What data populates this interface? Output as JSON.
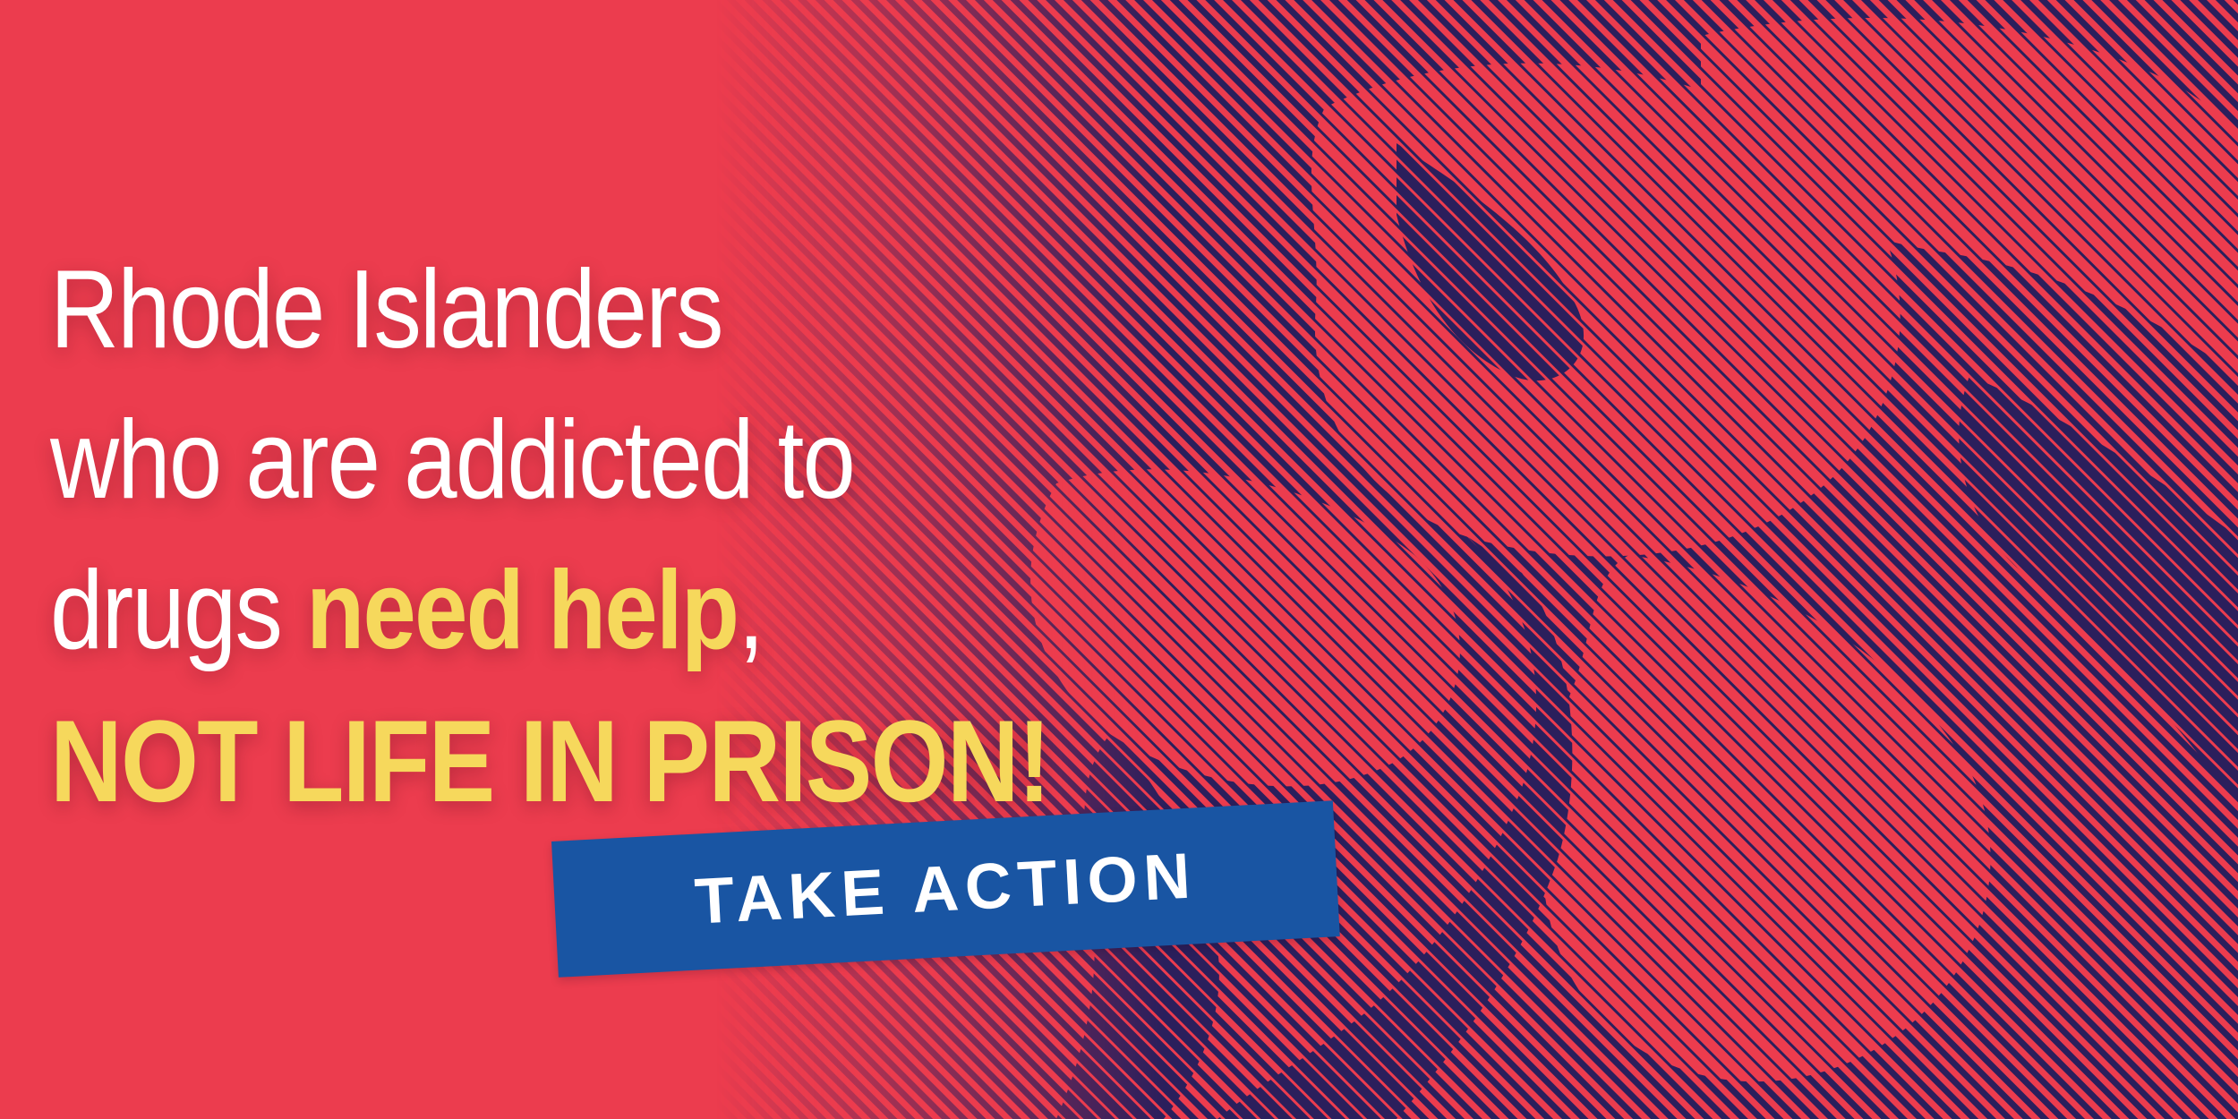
{
  "headline": {
    "line1": "Rhode Islanders",
    "line2": "who are addicted to",
    "line3_prefix": "drugs ",
    "line3_highlight": "need help",
    "line3_suffix": ",",
    "line4": "NOT LIFE IN PRISON!"
  },
  "cta": {
    "label": "TAKE ACTION"
  },
  "colors": {
    "background_red": "#ec3c4e",
    "stripe_navy": "#2b1f5c",
    "highlight_yellow": "#f6d85c",
    "button_blue": "#1955a3",
    "text_white": "#ffffff"
  },
  "photo": {
    "subject": "halftone-line-portrait"
  }
}
